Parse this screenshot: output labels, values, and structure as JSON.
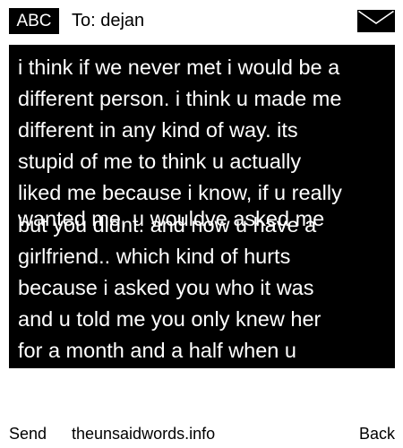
{
  "header": {
    "mode_badge": "ABC",
    "recipient": "To: dejan"
  },
  "message": {
    "lines": [
      "i think if we never met i would be a",
      "different person. i think u made me",
      "different in any kind of way. its",
      "stupid of me to think u actually",
      "liked me because i know, if u really",
      "wanted me, u wouldve asked me",
      "but you didnt. and now u have a",
      "girlfriend.. which kind of hurts",
      "because i asked you who it was",
      "and u told me you only knew her",
      "for a month and a half when u"
    ]
  },
  "footer": {
    "send_label": "Send",
    "site": "theunsaidwords.info",
    "back_label": "Back"
  },
  "icons": {
    "envelope": "envelope-icon"
  },
  "colors": {
    "background": "#ffffff",
    "message_box": "#000000",
    "message_text": "#ffffff",
    "badge": "#000000"
  }
}
